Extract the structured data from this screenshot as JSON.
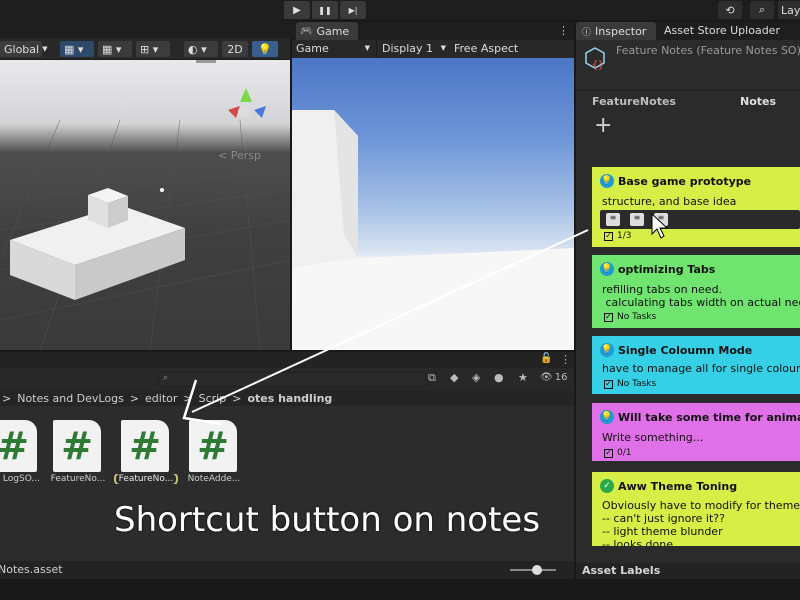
{
  "playbar": {
    "play": "▶",
    "pause": "❚❚",
    "step": "▶|",
    "history_icon": "⟲",
    "search_icon": "⌕",
    "layers_label": "Lay"
  },
  "scene": {
    "global_label": "Global",
    "mode_2d": "2D",
    "persp_label": "< Persp"
  },
  "game": {
    "tab_label": "Game",
    "menu_icon": "⋮",
    "display_mode": "Game",
    "display": "Display 1",
    "aspect": "Free Aspect"
  },
  "project": {
    "lock_icon": "🔒",
    "menu_icon": "⋮",
    "hidden_count": "16",
    "breadcrumb": [
      "Notes and DevLogs",
      "editor",
      "Scrip",
      "otes handling"
    ],
    "breadcrumb_sep": ">",
    "assets": [
      {
        "label": "LogSO...",
        "icon": "#"
      },
      {
        "label": "FeatureNo...",
        "icon": "#"
      },
      {
        "label": "FeatureNo...",
        "icon": "#"
      },
      {
        "label": "NoteAdde...",
        "icon": "#"
      }
    ],
    "footer_file": "Notes.asset"
  },
  "caption": "Shortcut button on notes",
  "inspector": {
    "tab_label": "Inspector",
    "tab2_label": "Asset Store Uploader",
    "menu_icon": "⋮",
    "object_title": "Feature Notes (Feature Notes SO)",
    "col_left": "FeatureNotes",
    "col_right": "Notes",
    "add_icon": "+",
    "footer": "Asset Labels",
    "notes": [
      {
        "title": "Base game prototype",
        "body": "structure, and base idea",
        "task": "1/3",
        "color": "#d6ee45"
      },
      {
        "title": "optimizing Tabs",
        "body": "refilling tabs on need.\n calculating tabs width on actual need.",
        "task": "No Tasks",
        "color": "#6fe46f"
      },
      {
        "title": "Single Coloumn Mode",
        "body": "have to manage all for single coloumn m",
        "task": "No Tasks",
        "color": "#35d0e5"
      },
      {
        "title": "Will take some time for animations",
        "body": "Write something...",
        "task": "0/1",
        "color": "#e070e8"
      },
      {
        "title": "Aww Theme Toning",
        "body": "Obviously have to modify for theme cha\n-- can't just ignore it??\n-- light theme blunder\n-- looks done",
        "task": "",
        "color": "#d6ee45"
      }
    ]
  }
}
